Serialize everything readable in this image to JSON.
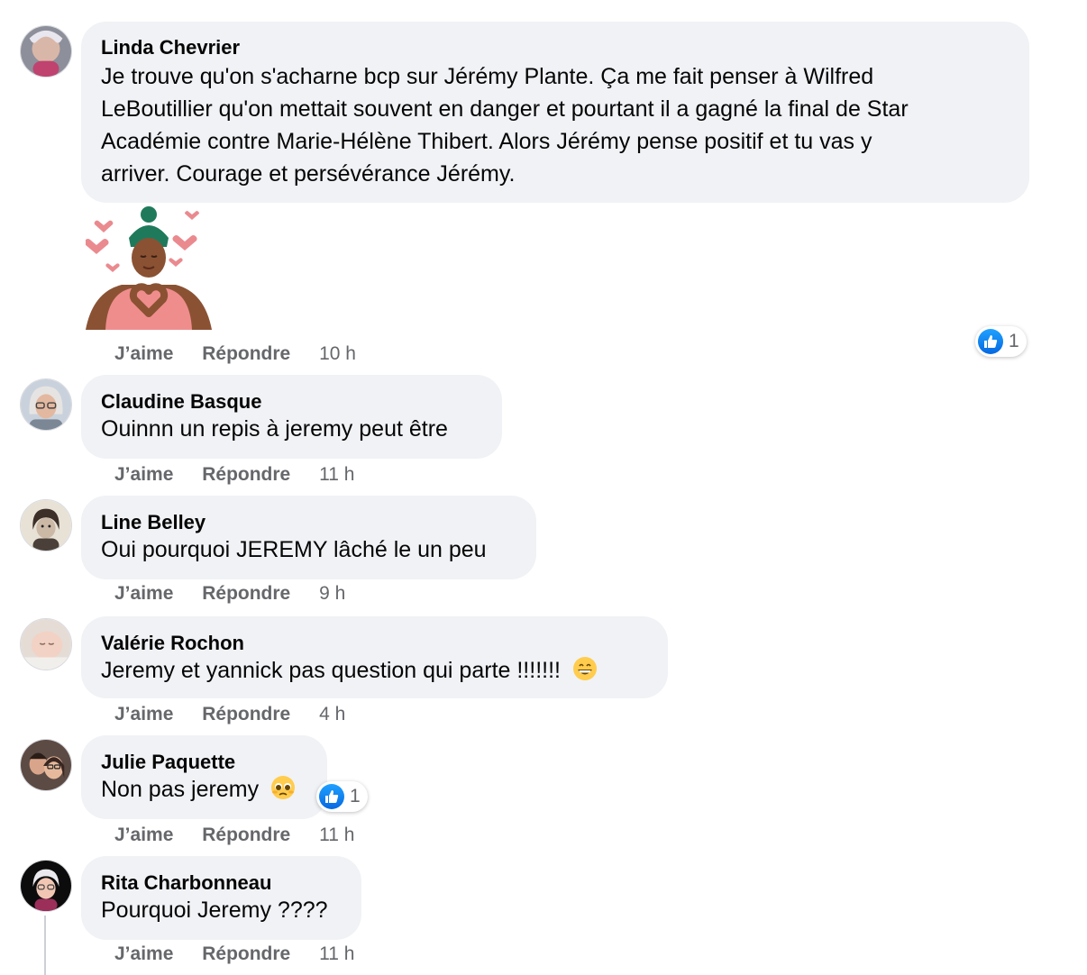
{
  "comments": [
    {
      "author": "Linda Chevrier",
      "text_lines": [
        "Je trouve qu'on s'acharne bcp sur Jérémy Plante. Ça me fait penser à Wilfred",
        "LeBoutillier qu'on mettait souvent en danger et pourtant il a gagné la final de Star",
        "Académie contre Marie-Hélène Thibert. Alors Jérémy pense positif et tu vas y",
        "arriver. Courage et persévérance Jérémy."
      ],
      "like_label": "J’aime",
      "reply_label": "Répondre",
      "time": "10 h",
      "reaction_count": "1",
      "sticker": "heart-hands-sticker"
    },
    {
      "author": "Claudine Basque",
      "text": "Ouinnn un repis à jeremy peut être",
      "like_label": "J’aime",
      "reply_label": "Répondre",
      "time": "11 h"
    },
    {
      "author": "Line Belley",
      "text": "Oui pourquoi JEREMY lâché le un peu",
      "like_label": "J’aime",
      "reply_label": "Répondre",
      "time": "9 h"
    },
    {
      "author": "Valérie Rochon",
      "text": "Jeremy et yannick pas question qui parte !!!!!!!",
      "emoji": "grinning-face-emoji",
      "like_label": "J’aime",
      "reply_label": "Répondre",
      "time": "4 h"
    },
    {
      "author": "Julie Paquette",
      "text": "Non pas jeremy",
      "emoji": "pleading-face-emoji",
      "reaction_count": "1",
      "like_label": "J’aime",
      "reply_label": "Répondre",
      "time": "11 h"
    },
    {
      "author": "Rita Charbonneau",
      "text": "Pourquoi Jeremy ????",
      "like_label": "J’aime",
      "reply_label": "Répondre",
      "time": "11 h"
    }
  ],
  "colors": {
    "bubble": "#f0f2f5",
    "meta_text": "#65676b",
    "like_blue": "#0866ff"
  }
}
